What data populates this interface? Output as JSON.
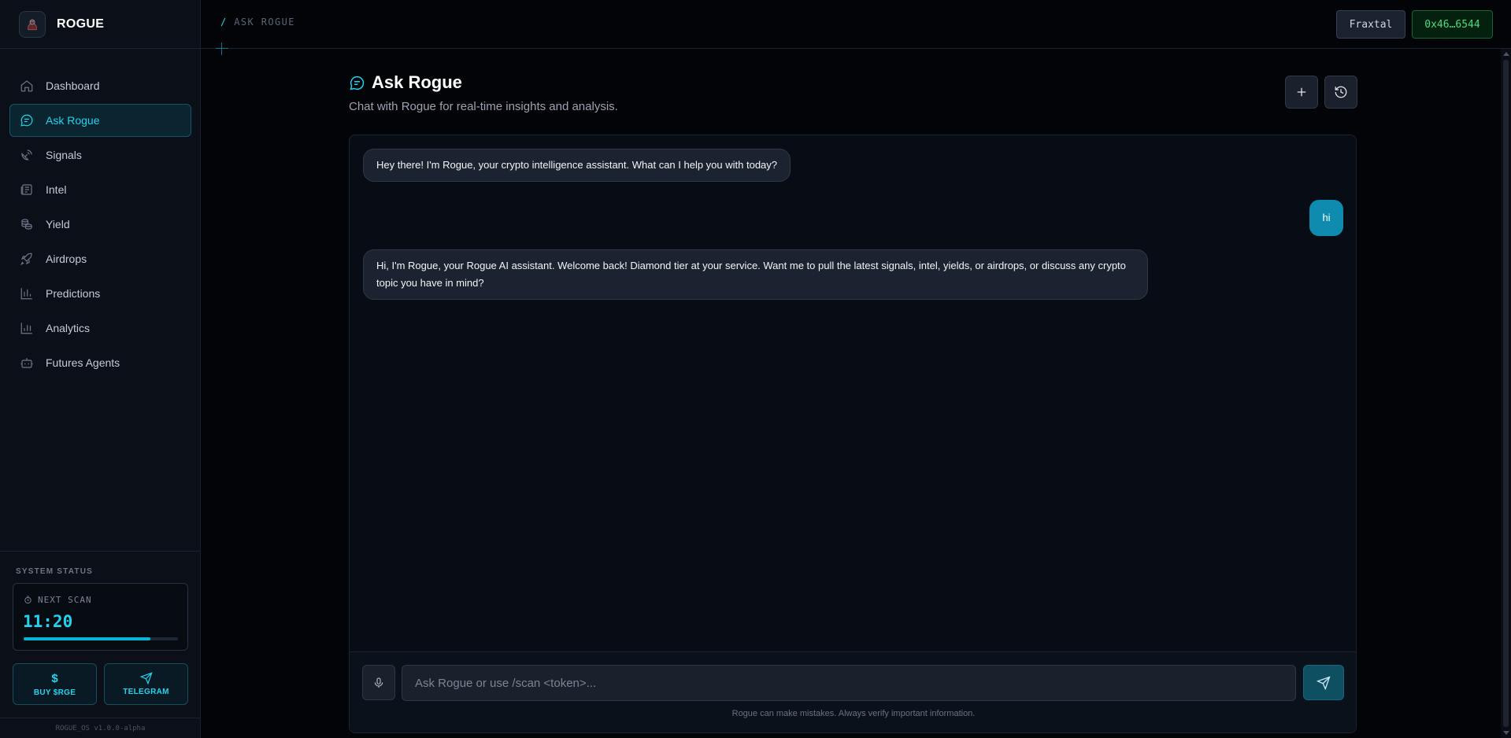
{
  "brand": {
    "name": "ROGUE"
  },
  "sidebar": {
    "items": [
      {
        "label": "Dashboard",
        "icon": "home-icon"
      },
      {
        "label": "Ask Rogue",
        "icon": "chat-bubble-icon",
        "active": true
      },
      {
        "label": "Signals",
        "icon": "satellite-dish-icon"
      },
      {
        "label": "Intel",
        "icon": "newspaper-icon"
      },
      {
        "label": "Yield",
        "icon": "coins-icon"
      },
      {
        "label": "Airdrops",
        "icon": "rocket-icon"
      },
      {
        "label": "Predictions",
        "icon": "bar-chart-icon"
      },
      {
        "label": "Analytics",
        "icon": "bar-chart-icon"
      },
      {
        "label": "Futures Agents",
        "icon": "bot-icon"
      }
    ],
    "system_status": {
      "title": "SYSTEM STATUS",
      "next_scan_label": "NEXT SCAN",
      "next_scan_time": "11:20",
      "progress_fraction": 0.82
    },
    "buy_label": "BUY $RGE",
    "buy_glyph": "$",
    "telegram_label": "TELEGRAM",
    "version": "ROGUE_OS v1.0.0-alpha"
  },
  "topbar": {
    "breadcrumb_slash": "/",
    "breadcrumb": "ASK ROGUE",
    "network": "Fraxtal",
    "wallet": "0x46…6544"
  },
  "page": {
    "title": "Ask Rogue",
    "subtitle": "Chat with Rogue for real-time insights and analysis."
  },
  "chat": {
    "messages": [
      {
        "role": "assistant",
        "text": "Hey there! I'm Rogue, your crypto intelligence assistant. What can I help you with today?"
      },
      {
        "role": "user",
        "text": "hi"
      },
      {
        "role": "assistant",
        "text": "Hi, I'm Rogue, your Rogue AI assistant. Welcome back! Diamond tier at your service. Want me to pull the latest signals, intel, yields, or airdrops, or discuss any crypto topic you have in mind?"
      }
    ],
    "input_placeholder": "Ask Rogue or use /scan <token>...",
    "input_value": "",
    "disclaimer": "Rogue can make mistakes. Always verify important information."
  },
  "colors": {
    "accent": "#22d3ee",
    "background": "#020408",
    "sidebar": "#0a0f18",
    "user_bubble": "#0e8bae",
    "wallet_text": "#4ade80"
  }
}
